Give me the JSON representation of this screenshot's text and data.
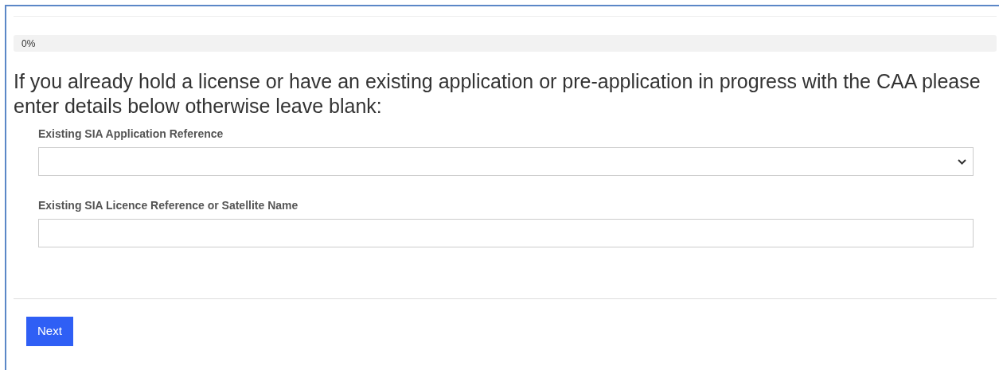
{
  "progress": {
    "level": 0,
    "reading": "0%"
  },
  "question": "If you already hold a license or have an existing application or pre-application in progress with the CAA please enter details below otherwise leave blank:",
  "fields": [
    {
      "kind": "select",
      "label": "Existing SIA Application Reference"
    },
    {
      "kind": "text",
      "label": "Existing SIA Licence Reference or Satellite Name"
    }
  ],
  "buttons": [
    {
      "label": "Next"
    }
  ]
}
